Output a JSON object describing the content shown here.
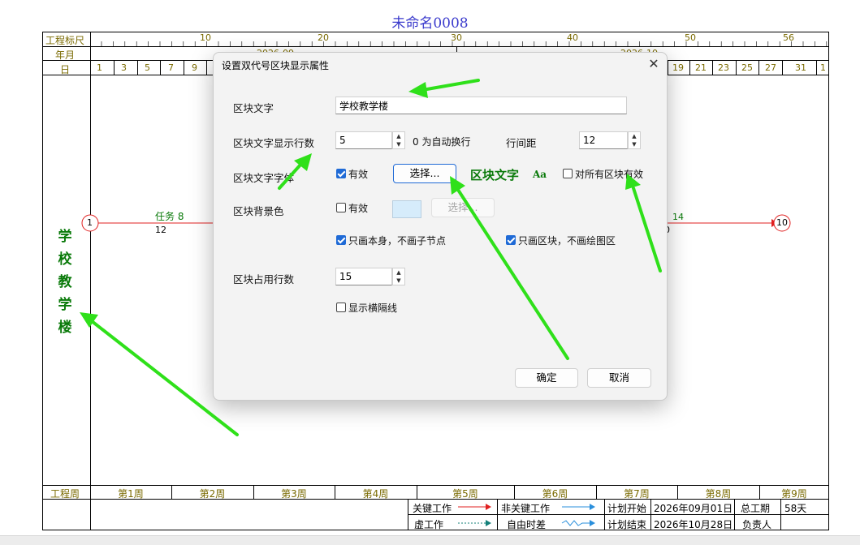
{
  "chart_title": "未命名0008",
  "header": {
    "scale_label": "工程标尺",
    "month_label": "年月",
    "day_label": "日",
    "scale_ticks": [
      "10",
      "20",
      "30",
      "40",
      "50",
      "56"
    ],
    "months": [
      "2026-09",
      "2026-10"
    ],
    "days_left": [
      "1",
      "3",
      "5",
      "7",
      "9"
    ],
    "days_right": [
      "19",
      "21",
      "23",
      "25",
      "27",
      "31",
      "1"
    ]
  },
  "block": {
    "chars": [
      "学",
      "校",
      "教",
      "学",
      "楼"
    ]
  },
  "tasks": {
    "node_start": "1",
    "node_end": "10",
    "task_label": "任务 8",
    "task_duration": "12",
    "right_label": "14",
    "right_duration": "0"
  },
  "weeks": {
    "label": "工程周",
    "items": [
      "第1周",
      "第2周",
      "第3周",
      "第4周",
      "第5周",
      "第6周",
      "第7周",
      "第8周",
      "第9周"
    ]
  },
  "legend": {
    "critical": "关键工作",
    "noncritical": "非关键工作",
    "dummy": "虚工作",
    "float": "自由时差",
    "plan_start_label": "计划开始",
    "plan_start_value": "2026年09月01日",
    "plan_end_label": "计划结束",
    "plan_end_value": "2026年10月28日",
    "total_label": "总工期",
    "total_value": "58天",
    "owner_label": "负责人",
    "owner_value": ""
  },
  "dialog": {
    "title": "设置双代号区块显示属性",
    "text_label": "区块文字",
    "text_value": "学校教学楼",
    "rows_label": "区块文字显示行数",
    "rows_value": "5",
    "rows_hint": "0 为自动换行",
    "spacing_label": "行间距",
    "spacing_value": "12",
    "font_label": "区块文字字体",
    "font_valid": "有效",
    "font_choose": "选择...",
    "font_preview": "区块文字",
    "font_preview_aa": "Aa",
    "apply_all": "对所有区块有效",
    "bg_label": "区块背景色",
    "bg_valid": "有效",
    "bg_choose": "选择...",
    "only_self": "只画本身，不画子节点",
    "only_block": "只画区块，不画绘图区",
    "occupy_label": "区块占用行数",
    "occupy_value": "15",
    "show_hline": "显示横隔线",
    "ok": "确定",
    "cancel": "取消"
  },
  "colors": {
    "accent": "#1f6ad6",
    "block_text": "#0a7a0a",
    "critical_line": "#e02020",
    "noncritical_line": "#2a8fdc",
    "arrow_green": "#2fe01a",
    "bg_swatch": "#d6ecfb"
  }
}
